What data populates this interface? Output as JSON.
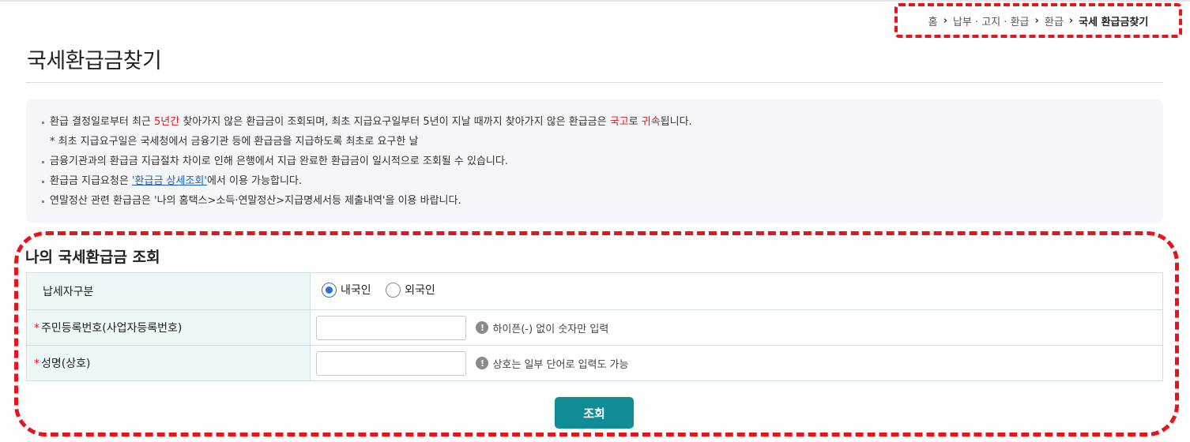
{
  "breadcrumb": [
    "홈",
    "납부 · 고지 · 환급",
    "환급",
    "국세 환급금찾기"
  ],
  "breadcrumb_sep": "›",
  "page_title": "국세환급금찾기",
  "notice": {
    "line1_a": "환급 결정일로부터 최근 ",
    "line1_b": "5년간",
    "line1_c": " 찾아가지 않은 환급금이 조회되며, 최초 지급요구일부터 5년이 지날 때까지 찾아가지 않은 환급금은 ",
    "line1_d": "국고",
    "line1_e": "로 ",
    "line1_f": "귀속",
    "line1_g": "됩니다.",
    "line2": "* 최초 지급요구일은 국세청에서 금융기관 등에 환급금을 지급하도록 최초로 요구한 날",
    "line3": "금융기관과의 환급금 지급절차 차이로 인해 은행에서 지급 완료한 환급금이 일시적으로 조회될 수 있습니다.",
    "line4_a": "환급금 지급요청은 ",
    "line4_link": "'환급금 상세조회'",
    "line4_b": "에서 이용 가능합니다.",
    "line5": "연말정산 관련 환급금은 '나의 홈택스>소득·연말정산>지급명세서등 제출내역'을 이용 바랍니다."
  },
  "section_title": "나의 국세환급금 조회",
  "form": {
    "taxpayer_type_label": "납세자구분",
    "radio_domestic": "내국인",
    "radio_foreign": "외국인",
    "selected": "내국인",
    "required_mark": "*",
    "id_label": "주민등록번호(사업자등록번호)",
    "id_value": "",
    "id_hint": "하이픈(-) 없이 숫자만 입력",
    "name_label": "성명(상호)",
    "name_value": "",
    "name_hint": "상호는 일부 단어로 입력도 가능",
    "info_glyph": "!"
  },
  "submit_label": "조회",
  "colors": {
    "accent": "#0f8c96",
    "highlight": "#e8141c",
    "link": "#1a5fcc"
  }
}
